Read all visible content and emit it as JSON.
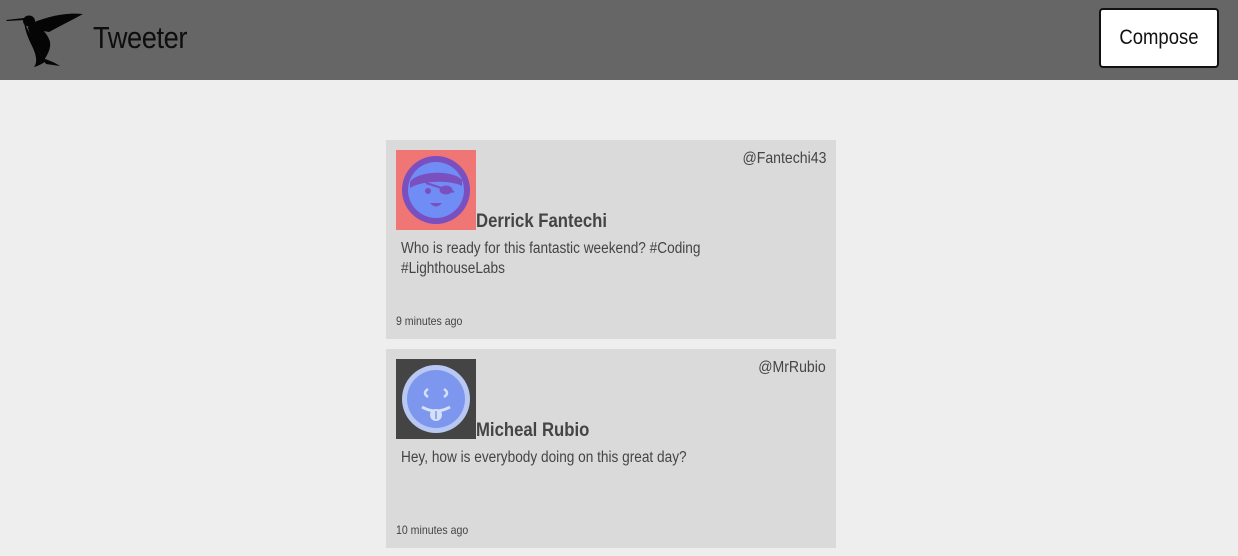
{
  "header": {
    "brand": "Tweeter",
    "compose_label": "Compose",
    "logo_icon": "hummingbird-icon"
  },
  "tweets": [
    {
      "name": "Derrick Fantechi",
      "handle": "@Fantechi43",
      "text": "Who is ready for this fantastic weekend? #Coding #LighthouseLabs",
      "time": "9 minutes ago",
      "avatar_icon": "pirate-face-avatar",
      "avatar_bg": "#f07575"
    },
    {
      "name": "Micheal Rubio",
      "handle": "@MrRubio",
      "text": "Hey, how is everybody doing on this great day?",
      "time": "10 minutes ago",
      "avatar_icon": "tongue-face-avatar",
      "avatar_bg": "#444444"
    }
  ]
}
